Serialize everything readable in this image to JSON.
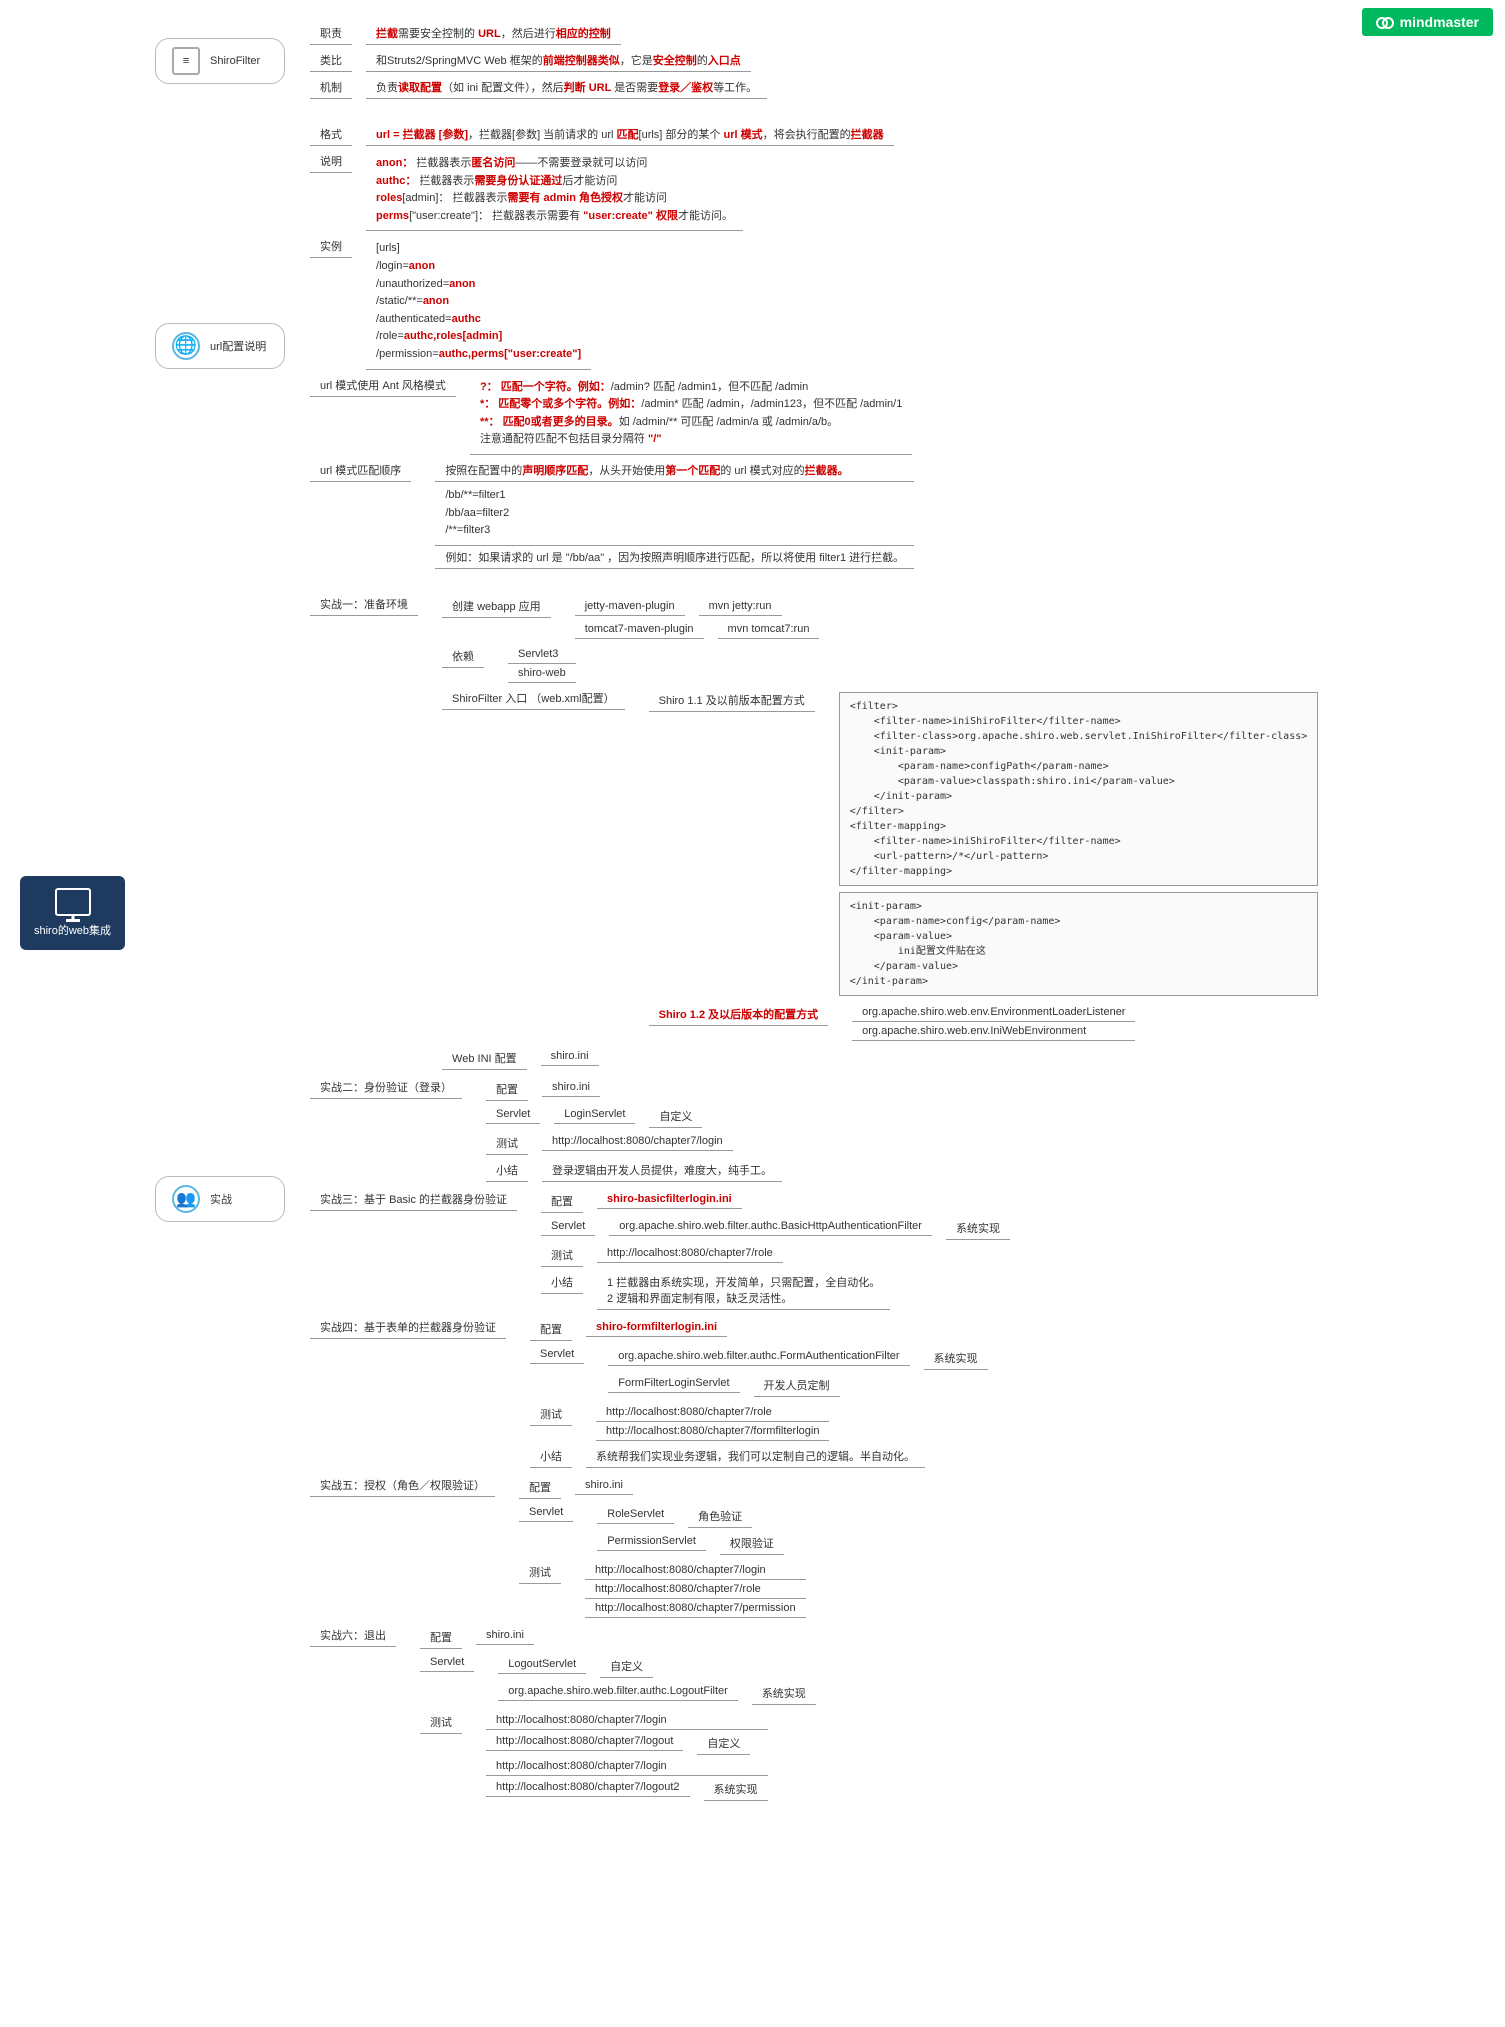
{
  "logo": "mindmaster",
  "root": "shiro的web集成",
  "shiroFilter": {
    "title": "ShiroFilter",
    "rows": [
      {
        "label": "职责",
        "pre": "",
        "hl1": "拦截",
        "mid1": "需要安全控制的 ",
        "hl2": "URL",
        "mid2": "，然后进行",
        "hl3": "相应的控制"
      },
      {
        "label": "类比",
        "pre": "和Struts2/SpringMVC Web 框架的",
        "hl1": "前端控制器类似",
        "mid1": "，它是",
        "hl2": "安全控制",
        "mid2": "的",
        "hl3": "入口点"
      },
      {
        "label": "机制",
        "pre": "负责",
        "hl1": "读取配置",
        "mid1": "（如 ini 配置文件），然后",
        "hl2": "判断 URL ",
        "mid2": "是否需要",
        "hl3": "登录／鉴权",
        "suf": "等工作。"
      }
    ]
  },
  "urlConfig": {
    "title": "url配置说明",
    "format": {
      "label": "格式",
      "pre": "",
      "hl": "url = 拦截器 [参数]",
      "mid": "，拦截器[参数]          当前请求的 url ",
      "hl2": "匹配",
      "mid2": "[urls] 部分的某个 ",
      "hl3": "url 模式",
      "mid3": "，将会执行配置的",
      "hl4": "拦截器"
    },
    "explain": {
      "label": "说明",
      "lines": [
        {
          "k": "anon：",
          "v": "拦截器表示",
          "hl": "匿名访问",
          "suf": "——不需要登录就可以访问"
        },
        {
          "k": "authc：",
          "v": "拦截器表示",
          "hl": "需要身份认证通过",
          "suf": "后才能访问"
        },
        {
          "k": "roles",
          "arg": "[admin]：",
          "v": "拦截器表示",
          "hl": "需要有 admin 角色授权",
          "suf": "才能访问"
        },
        {
          "k": "perms",
          "arg": "[\"user:create\"]：",
          "v": "拦截器表示需要有 ",
          "hl": "\"user:create\" 权限",
          "suf": "才能访问。"
        }
      ]
    },
    "example": {
      "label": "实例",
      "code": "[urls]\n/login=anon\n/unauthorized=anon\n/static/**=anon\n/authenticated=authc\n/role=authc,roles[admin]\n/permission=authc,perms[\"user:create\"]"
    },
    "ant": {
      "label": "url 模式使用 Ant 风格模式",
      "lines": [
        {
          "k": "?：",
          "hl": "匹配一个字符。例如：",
          "v": "/admin? 匹配 /admin1，但不匹配 /admin"
        },
        {
          "k": "*：",
          "hl": "匹配零个或多个字符。例如：",
          "v": "/admin* 匹配 /admin，/admin123，但不匹配 /admin/1"
        },
        {
          "k": "**：",
          "hl": "匹配0或者更多的目录。",
          "v": "如 /admin/** 可匹配 /admin/a 或 /admin/a/b。"
        },
        {
          "note": "注意通配符匹配不包括目录分隔符 ",
          "hl": "\"/\""
        }
      ]
    },
    "order": {
      "label": "url 模式匹配顺序",
      "head": {
        "pre": "按照在配置中的",
        "hl": "声明顺序匹配",
        "mid": "，从头开始使用",
        "hl2": "第一个匹配",
        "suf": "的 url 模式对应的",
        "hl3": "拦截器。"
      },
      "code": "/bb/**=filter1\n/bb/aa=filter2\n/**=filter3",
      "note": "例如：如果请求的 url 是 \"/bb/aa\" ，因为按照声明顺序进行匹配，所以将使用 filter1 进行拦截。"
    }
  },
  "practice": {
    "title": "实战",
    "p1": {
      "label": "实战一：准备环境",
      "webapp": {
        "label": "创建 webapp 应用",
        "r1": {
          "a": "jetty-maven-plugin",
          "b": "mvn jetty:run"
        },
        "r2": {
          "a": "tomcat7-maven-plugin",
          "b": "mvn tomcat7:run"
        }
      },
      "deps": {
        "label": "依赖",
        "d1": "Servlet3",
        "d2": "shiro-web"
      },
      "entry": {
        "label": "ShiroFilter 入口 （web.xml配置）",
        "v11label": "Shiro 1.1 及以前版本配置方式",
        "code1": "<filter>\n    <filter-name>iniShiroFilter</filter-name>\n    <filter-class>org.apache.shiro.web.servlet.IniShiroFilter</filter-class>\n    <init-param>\n        <param-name>configPath</param-name>\n        <param-value>classpath:shiro.ini</param-value>\n    </init-param>\n</filter>\n<filter-mapping>\n    <filter-name>iniShiroFilter</filter-name>\n    <url-pattern>/*</url-pattern>\n</filter-mapping>",
        "code2": "<init-param>\n    <param-name>config</param-name>\n    <param-value>\n        ini配置文件贴在这\n    </param-value>\n</init-param>",
        "v12label": "Shiro 1.2 及以后版本的配置方式",
        "c1": "org.apache.shiro.web.env.EnvironmentLoaderListener",
        "c2": "org.apache.shiro.web.env.IniWebEnvironment"
      },
      "ini": {
        "label": "Web INI 配置",
        "v": "shiro.ini"
      }
    },
    "p2": {
      "label": "实战二：身份验证（登录）",
      "cfg": {
        "label": "配置",
        "v": "shiro.ini"
      },
      "srv": {
        "label": "Servlet",
        "a": "LoginServlet",
        "b": "自定义"
      },
      "test": {
        "label": "测试",
        "v": "http://localhost:8080/chapter7/login"
      },
      "tip": {
        "label": "小结",
        "v": "登录逻辑由开发人员提供，难度大，纯手工。"
      }
    },
    "p3": {
      "label": "实战三：基于 Basic 的拦截器身份验证",
      "cfg": {
        "label": "配置",
        "v": "shiro-basicfilterlogin.ini"
      },
      "srv": {
        "label": "Servlet",
        "a": "org.apache.shiro.web.filter.authc.BasicHttpAuthenticationFilter",
        "b": "系统实现"
      },
      "test": {
        "label": "测试",
        "v": "http://localhost:8080/chapter7/role"
      },
      "tip": {
        "label": "小结",
        "v": "1 拦截器由系统实现，开发简单，只需配置，全自动化。\n2 逻辑和界面定制有限，缺乏灵活性。"
      }
    },
    "p4": {
      "label": "实战四：基于表单的拦截器身份验证",
      "cfg": {
        "label": "配置",
        "v": "shiro-formfilterlogin.ini"
      },
      "srv": {
        "label": "Servlet",
        "r1": {
          "a": "org.apache.shiro.web.filter.authc.FormAuthenticationFilter",
          "b": "系统实现"
        },
        "r2": {
          "a": "FormFilterLoginServlet",
          "b": "开发人员定制"
        }
      },
      "test": {
        "label": "测试",
        "v1": "http://localhost:8080/chapter7/role",
        "v2": "http://localhost:8080/chapter7/formfilterlogin"
      },
      "tip": {
        "label": "小结",
        "v": "系统帮我们实现业务逻辑，我们可以定制自己的逻辑。半自动化。"
      }
    },
    "p5": {
      "label": "实战五：授权（角色／权限验证）",
      "cfg": {
        "label": "配置",
        "v": "shiro.ini"
      },
      "srv": {
        "label": "Servlet",
        "r1": {
          "a": "RoleServlet",
          "b": "角色验证"
        },
        "r2": {
          "a": "PermissionServlet",
          "b": "权限验证"
        }
      },
      "test": {
        "label": "测试",
        "v1": "http://localhost:8080/chapter7/login",
        "v2": "http://localhost:8080/chapter7/role",
        "v3": "http://localhost:8080/chapter7/permission"
      }
    },
    "p6": {
      "label": "实战六：退出",
      "cfg": {
        "label": "配置",
        "v": "shiro.ini"
      },
      "srv": {
        "label": "Servlet",
        "r1": {
          "a": "LogoutServlet",
          "b": "自定义"
        },
        "r2": {
          "a": "org.apache.shiro.web.filter.authc.LogoutFilter",
          "b": "系统实现"
        }
      },
      "test": {
        "label": "测试",
        "r1": "http://localhost:8080/chapter7/login",
        "r2": {
          "a": "http://localhost:8080/chapter7/logout",
          "b": "自定义"
        },
        "r3": "http://localhost:8080/chapter7/login",
        "r4": {
          "a": "http://localhost:8080/chapter7/logout2",
          "b": "系统实现"
        }
      }
    }
  }
}
